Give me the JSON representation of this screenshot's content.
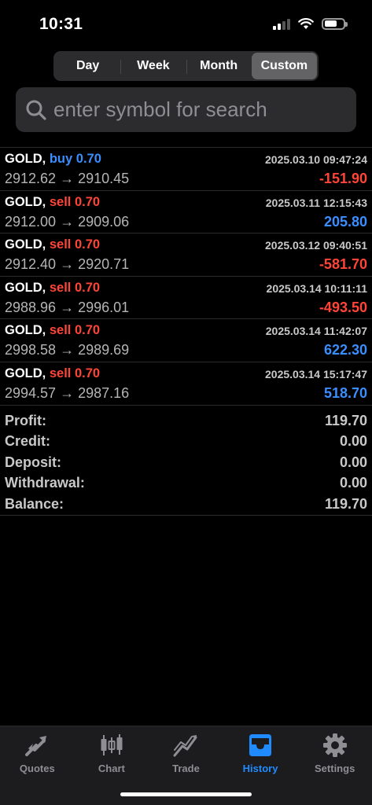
{
  "status": {
    "time": "10:31"
  },
  "period_tabs": [
    {
      "label": "Day",
      "active": false
    },
    {
      "label": "Week",
      "active": false
    },
    {
      "label": "Month",
      "active": false
    },
    {
      "label": "Custom",
      "active": true
    }
  ],
  "search": {
    "placeholder": "enter symbol for search",
    "value": ""
  },
  "trades": [
    {
      "symbol": "GOLD,",
      "side": "buy 0.70",
      "type": "buy",
      "open": "2912.62",
      "close": "2910.45",
      "datetime": "2025.03.10 09:47:24",
      "profit": "-151.90",
      "profit_sign": "neg"
    },
    {
      "symbol": "GOLD,",
      "side": "sell 0.70",
      "type": "sell",
      "open": "2912.00",
      "close": "2909.06",
      "datetime": "2025.03.11 12:15:43",
      "profit": "205.80",
      "profit_sign": "pos"
    },
    {
      "symbol": "GOLD,",
      "side": "sell 0.70",
      "type": "sell",
      "open": "2912.40",
      "close": "2920.71",
      "datetime": "2025.03.12 09:40:51",
      "profit": "-581.70",
      "profit_sign": "neg"
    },
    {
      "symbol": "GOLD,",
      "side": "sell 0.70",
      "type": "sell",
      "open": "2988.96",
      "close": "2996.01",
      "datetime": "2025.03.14 10:11:11",
      "profit": "-493.50",
      "profit_sign": "neg"
    },
    {
      "symbol": "GOLD,",
      "side": "sell 0.70",
      "type": "sell",
      "open": "2998.58",
      "close": "2989.69",
      "datetime": "2025.03.14 11:42:07",
      "profit": "622.30",
      "profit_sign": "pos"
    },
    {
      "symbol": "GOLD,",
      "side": "sell 0.70",
      "type": "sell",
      "open": "2994.57",
      "close": "2987.16",
      "datetime": "2025.03.14 15:17:47",
      "profit": "518.70",
      "profit_sign": "pos"
    }
  ],
  "summary": [
    {
      "label": "Profit:",
      "value": "119.70"
    },
    {
      "label": "Credit:",
      "value": "0.00"
    },
    {
      "label": "Deposit:",
      "value": "0.00"
    },
    {
      "label": "Withdrawal:",
      "value": "0.00"
    },
    {
      "label": "Balance:",
      "value": "119.70"
    }
  ],
  "tabbar": [
    {
      "label": "Quotes",
      "icon": "quotes-icon",
      "active": false
    },
    {
      "label": "Chart",
      "icon": "candlestick-icon",
      "active": false
    },
    {
      "label": "Trade",
      "icon": "trade-icon",
      "active": false
    },
    {
      "label": "History",
      "icon": "inbox-icon",
      "active": true
    },
    {
      "label": "Settings",
      "icon": "gear-icon",
      "active": false
    }
  ],
  "colors": {
    "buy": "#3a8eff",
    "sell": "#ff4438",
    "accent": "#1f8bff",
    "background": "#000000"
  }
}
